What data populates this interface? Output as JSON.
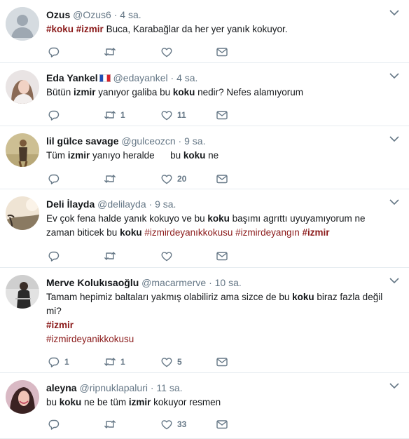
{
  "tweets": [
    {
      "name": "Ozus",
      "handle": "@Ozus6",
      "dot": "·",
      "time": "4 sa.",
      "lines": [
        [
          {
            "t": "#koku",
            "h": 1,
            "b": 1
          },
          {
            "t": " "
          },
          {
            "t": "#izmir",
            "h": 1,
            "b": 1
          },
          {
            "t": " Buca, Karabağlar da her yer yanık kokuyor."
          }
        ]
      ],
      "replies": "",
      "retweets": "",
      "likes": ""
    },
    {
      "name": "Eda Yankel",
      "handle": "@edayankel",
      "dot": "·",
      "time": "4 sa.",
      "lines": [
        [
          {
            "t": "Bütün "
          },
          {
            "t": "izmir",
            "b": 1
          },
          {
            "t": " yanıyor galiba bu "
          },
          {
            "t": "koku",
            "b": 1
          },
          {
            "t": " nedir? Nefes alamıyorum"
          }
        ]
      ],
      "replies": "",
      "retweets": "1",
      "likes": "11"
    },
    {
      "name": "lil gülce savage",
      "handle": "@gulceozcn",
      "dot": "·",
      "time": "9 sa.",
      "lines": [
        [
          {
            "t": "Tüm "
          },
          {
            "t": "izmir",
            "b": 1
          },
          {
            "t": " yanıyo heralde      bu "
          },
          {
            "t": "koku",
            "b": 1
          },
          {
            "t": " ne"
          }
        ]
      ],
      "replies": "",
      "retweets": "",
      "likes": "20"
    },
    {
      "name": "Deli İlayda",
      "handle": "@delilayda",
      "dot": "·",
      "time": "9 sa.",
      "lines": [
        [
          {
            "t": "Ev çok fena halde yanık kokuyo ve bu "
          },
          {
            "t": "koku",
            "b": 1
          },
          {
            "t": " başımı agrıttı uyuyamıyorum ne"
          }
        ],
        [
          {
            "t": "zaman biticek bu "
          },
          {
            "t": "koku",
            "b": 1
          },
          {
            "t": " "
          },
          {
            "t": "#izmirdeyanıkkokusu",
            "h": 1
          },
          {
            "t": " "
          },
          {
            "t": "#izmirdeyangın",
            "h": 1
          },
          {
            "t": " "
          },
          {
            "t": "#izmir",
            "h": 1,
            "b": 1
          }
        ]
      ],
      "replies": "",
      "retweets": "",
      "likes": ""
    },
    {
      "name": "Merve Kolukısaoğlu",
      "handle": "@macarmerve",
      "dot": "·",
      "time": "10 sa.",
      "lines": [
        [
          {
            "t": "Tamam hepimiz baltaları yakmış olabiliriz ama sizce de bu "
          },
          {
            "t": "koku",
            "b": 1
          },
          {
            "t": " biraz fazla değil"
          }
        ],
        [
          {
            "t": "mi?"
          }
        ],
        [
          {
            "t": "#izmir",
            "h": 1,
            "b": 1
          }
        ],
        [
          {
            "t": "#izmirdeyanikkokusu",
            "h": 1
          }
        ]
      ],
      "replies": "1",
      "retweets": "1",
      "likes": "5"
    },
    {
      "name": "aleyna",
      "handle": "@ripnuklapaluri",
      "dot": "·",
      "time": "11 sa.",
      "lines": [
        [
          {
            "t": "bu "
          },
          {
            "t": "koku",
            "b": 1
          },
          {
            "t": " ne be tüm "
          },
          {
            "t": "izmir",
            "b": 1
          },
          {
            "t": " kokuyor resmen"
          }
        ]
      ],
      "replies": "",
      "retweets": "",
      "likes": "33"
    }
  ],
  "colors": {
    "hashtag": "#8b1a1a",
    "muted": "#657786",
    "border": "#e6ecf0"
  },
  "icons": [
    "reply-icon",
    "retweet-icon",
    "like-icon",
    "direct-message-icon",
    "chevron-down-icon",
    "france-flag-icon"
  ]
}
